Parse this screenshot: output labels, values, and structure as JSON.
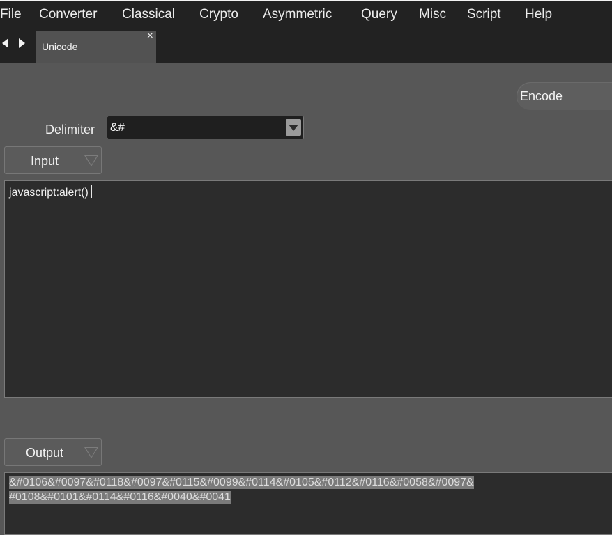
{
  "menu": [
    "File",
    "Converter",
    "Classical",
    "Crypto",
    "Asymmetric",
    "Query",
    "Misc",
    "Script",
    "Help"
  ],
  "tab": {
    "label": "Unicode",
    "close": "×"
  },
  "encode_button": "Encode",
  "delimiter": {
    "label": "Delimiter",
    "value": "&#"
  },
  "input": {
    "mode": "Input",
    "text": "javascript:alert()"
  },
  "output": {
    "mode": "Output",
    "lines": [
      "&#0106&#0097&#0118&#0097&#0115&#0099&#0114&#0105&#0112&#0116&#0058&#0097&",
      "#0108&#0101&#0114&#0116&#0040&#0041"
    ]
  }
}
